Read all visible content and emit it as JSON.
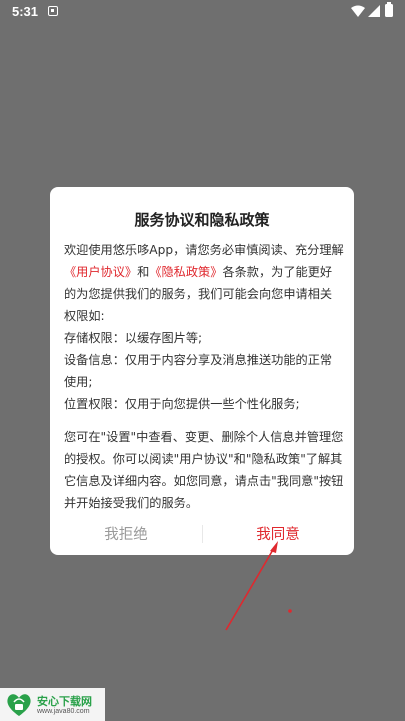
{
  "status_bar": {
    "time": "5:31"
  },
  "dialog": {
    "title": "服务协议和隐私政策",
    "para1_before": "欢迎使用悠乐哆App，请您务必审慎阅读、充分理解",
    "link_user": "《用户协议》",
    "and": "和",
    "link_privacy": "《隐私政策》",
    "para1_after": "各条款，为了能更好的为您提供我们的服务，我们可能会向您申请相关权限如:",
    "perm_storage": "存储权限：以缓存图片等;",
    "perm_device": "设备信息：仅用于内容分享及消息推送功能的正常使用;",
    "perm_location": "位置权限：仅用于向您提供一些个性化服务;",
    "para2": "您可在\"设置\"中查看、变更、删除个人信息并管理您的授权。你可以阅读\"用户协议\"和\"隐私政策\"了解其它信息及详细内容。如您同意，请点击\"我同意\"按钮并开始接受我们的服务。",
    "reject_label": "我拒绝",
    "agree_label": "我同意"
  },
  "watermark": {
    "logo_text": "安心\n下载",
    "name": "安心下载网",
    "url": "www.java80.com"
  },
  "colors": {
    "accent": "#e0282e",
    "overlay": "#6f6f6f",
    "watermark_green": "#2aa14a"
  }
}
